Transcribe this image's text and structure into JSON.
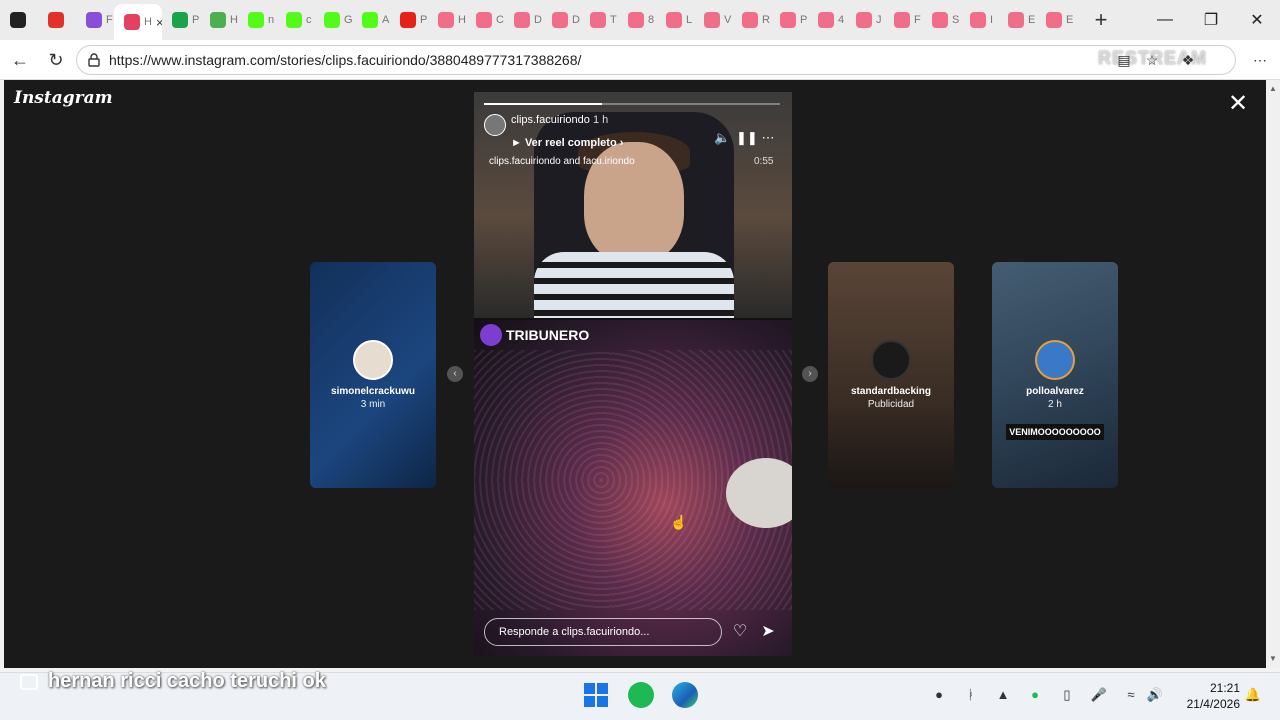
{
  "browser": {
    "tabs": [
      {
        "label": "",
        "color": "#222"
      },
      {
        "label": "",
        "color": "#e2302a"
      },
      {
        "label": "F",
        "color": "#8a4fd8"
      },
      {
        "label": "H",
        "color": "#e4405f",
        "active": true
      },
      {
        "label": "P",
        "color": "#1aa34a"
      },
      {
        "label": "H",
        "color": "#4caf50"
      },
      {
        "label": "n",
        "color": "#53fc18"
      },
      {
        "label": "c",
        "color": "#53fc18"
      },
      {
        "label": "G",
        "color": "#53fc18"
      },
      {
        "label": "A",
        "color": "#53fc18"
      },
      {
        "label": "P",
        "color": "#e62117"
      },
      {
        "label": "H",
        "color": "#f06e8a"
      },
      {
        "label": "C",
        "color": "#f06e8a"
      },
      {
        "label": "D",
        "color": "#f06e8a"
      },
      {
        "label": "D",
        "color": "#f06e8a"
      },
      {
        "label": "T",
        "color": "#f06e8a"
      },
      {
        "label": "8",
        "color": "#f06e8a"
      },
      {
        "label": "L",
        "color": "#f06e8a"
      },
      {
        "label": "V",
        "color": "#f06e8a"
      },
      {
        "label": "R",
        "color": "#f06e8a"
      },
      {
        "label": "P",
        "color": "#f06e8a"
      },
      {
        "label": "4",
        "color": "#f06e8a"
      },
      {
        "label": "J",
        "color": "#f06e8a"
      },
      {
        "label": "F",
        "color": "#f06e8a"
      },
      {
        "label": "S",
        "color": "#f06e8a"
      },
      {
        "label": "I",
        "color": "#f06e8a"
      },
      {
        "label": "E",
        "color": "#f06e8a"
      },
      {
        "label": "E",
        "color": "#f06e8a"
      }
    ],
    "url": "https://www.instagram.com/stories/clips.facuiriondo/3880489777317388268/",
    "watermark": "RESTREAM"
  },
  "instagram": {
    "logo": "Instagram",
    "story": {
      "username": "clips.facuiriondo",
      "time": "1 h",
      "reel_link": "Ver reel completo",
      "collab": "clips.facuiriondo and facu.iriondo",
      "duration": "0:55",
      "overlay_brand": "TRIBUNERO",
      "reply_placeholder": "Responde a clips.facuiriondo..."
    },
    "previews": [
      {
        "name": "simonelcrackuwu",
        "sub": "3 min"
      },
      {
        "name": "standardbacking",
        "sub": "Publicidad"
      },
      {
        "name": "polloalvarez",
        "sub": "2 h",
        "tag": "VENIMOOOOOOOOO"
      }
    ]
  },
  "caption": "hernan ricci cacho teruchi ok",
  "system": {
    "time": "21:21",
    "date": "21/4/2026"
  }
}
